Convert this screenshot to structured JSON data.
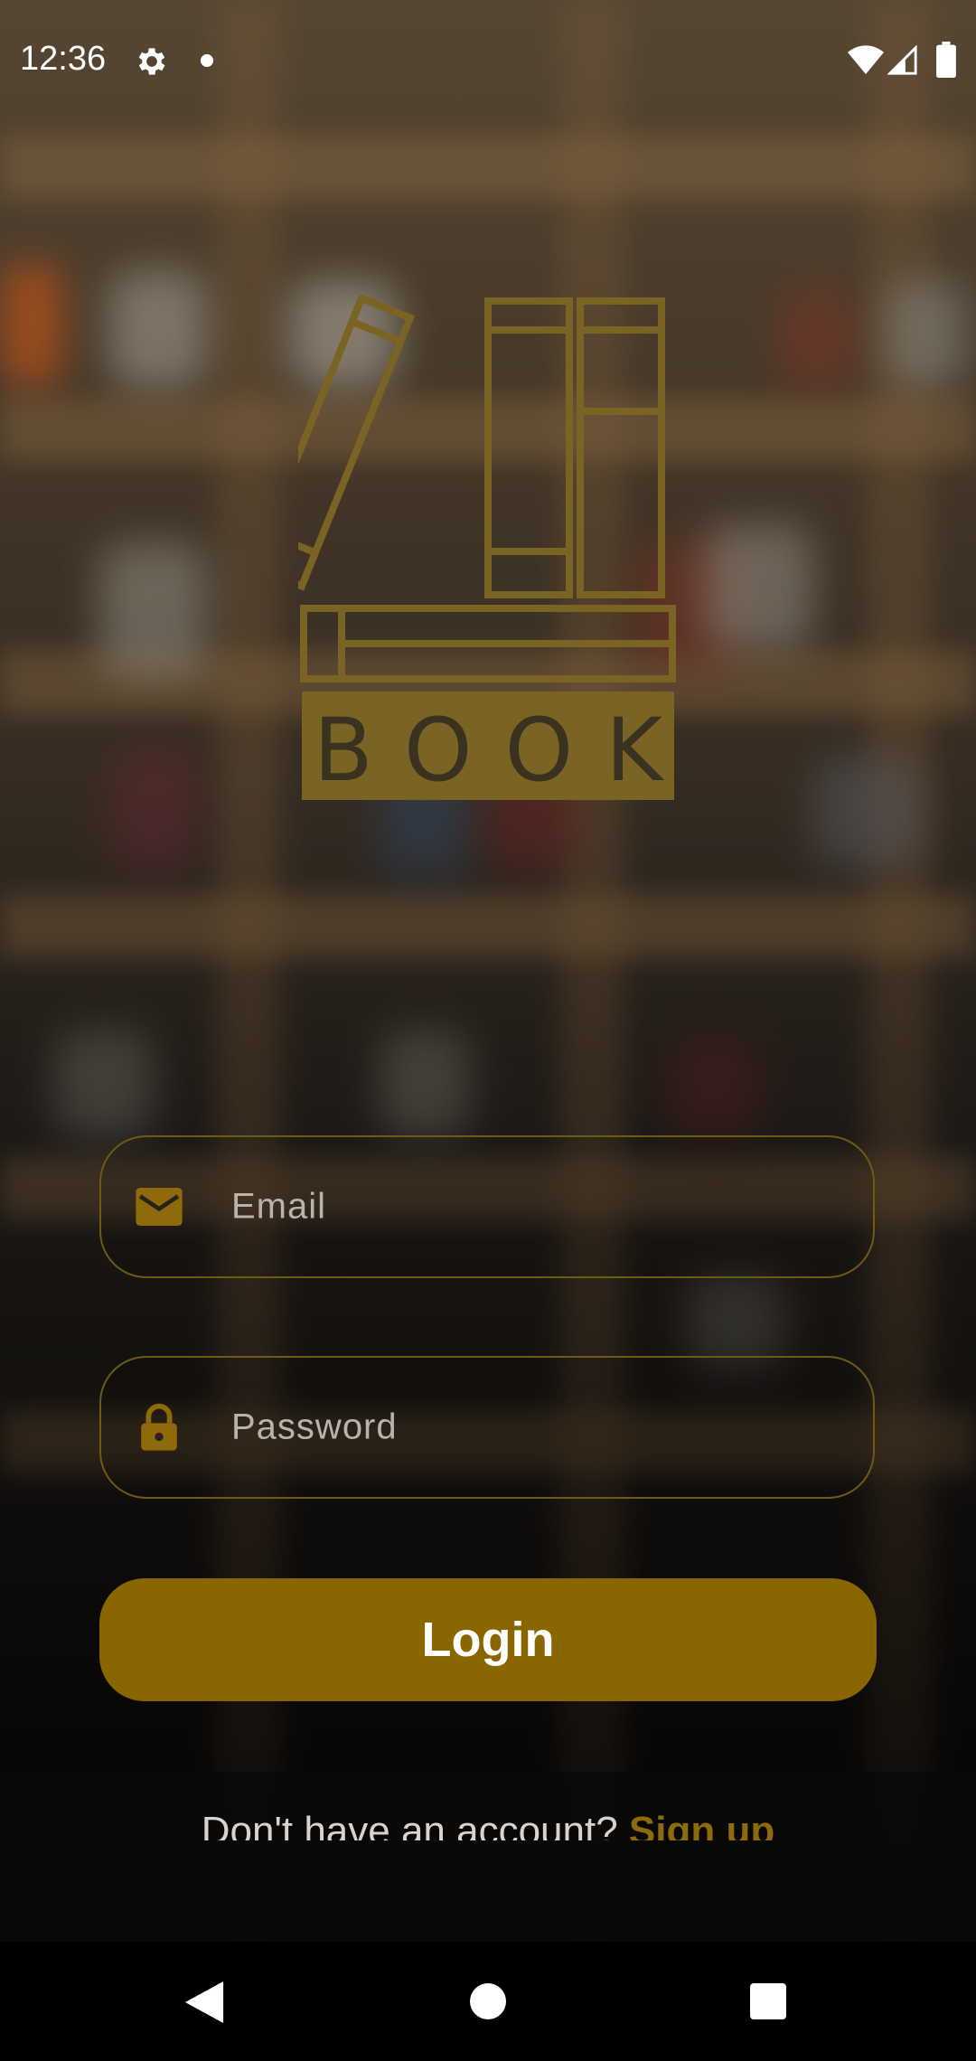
{
  "status_bar": {
    "time": "12:36",
    "icons": [
      "gear-icon",
      "notification-dot",
      "wifi-icon",
      "signal-icon",
      "battery-icon"
    ]
  },
  "logo": {
    "text": "BOOK",
    "color": "#7a6424"
  },
  "form": {
    "email_placeholder": "Email",
    "password_placeholder": "Password",
    "login_label": "Login"
  },
  "signup": {
    "question": "Don't have an account?",
    "link": "Sign up"
  },
  "nav": {
    "icons": [
      "back-icon",
      "home-icon",
      "recents-icon"
    ]
  },
  "colors": {
    "accent": "#896600",
    "field_border": "#6e5a15",
    "link": "#8d6a0a"
  }
}
